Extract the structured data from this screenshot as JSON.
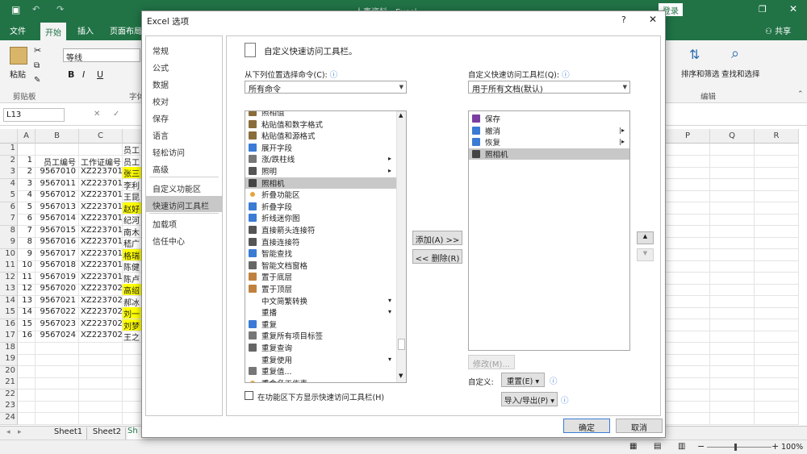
{
  "excel": {
    "title": "人事资料 - Excel",
    "login": "登录",
    "share": "共享",
    "tabs": [
      "文件",
      "开始",
      "插入",
      "页面布局"
    ],
    "ribbon": {
      "paste": "粘贴",
      "clipboard": "剪贴板",
      "font_name": "等线",
      "font_group": "字体",
      "sort_filter": "排序和筛选",
      "find_select": "查找和选择",
      "editing": "编辑"
    },
    "name_box": "L13",
    "columns": [
      "A",
      "B",
      "C",
      "P",
      "Q",
      "R"
    ],
    "rows": [
      {
        "n": "1",
        "a": "",
        "b": "",
        "c": "",
        "d": "员工"
      },
      {
        "n": "2",
        "a": "1",
        "b": "员工编号",
        "c": "工作证编号",
        "d": "员工"
      },
      {
        "n": "3",
        "a": "2",
        "b": "9567010",
        "c": "XZ223701",
        "d": "张三",
        "hl": true
      },
      {
        "n": "4",
        "a": "3",
        "b": "9567011",
        "c": "XZ223701",
        "d": "李利"
      },
      {
        "n": "5",
        "a": "4",
        "b": "9567012",
        "c": "XZ223701",
        "d": "王昆"
      },
      {
        "n": "6",
        "a": "5",
        "b": "9567013",
        "c": "XZ223701",
        "d": "赵好",
        "hl": true
      },
      {
        "n": "7",
        "a": "6",
        "b": "9567014",
        "c": "XZ223701",
        "d": "纪河"
      },
      {
        "n": "8",
        "a": "7",
        "b": "9567015",
        "c": "XZ223701",
        "d": "南木"
      },
      {
        "n": "9",
        "a": "8",
        "b": "9567016",
        "c": "XZ223701",
        "d": "嵇广"
      },
      {
        "n": "10",
        "a": "9",
        "b": "9567017",
        "c": "XZ223701",
        "d": "格瑞",
        "hl": true
      },
      {
        "n": "11",
        "a": "10",
        "b": "9567018",
        "c": "XZ223701",
        "d": "陈健"
      },
      {
        "n": "12",
        "a": "11",
        "b": "9567019",
        "c": "XZ223701",
        "d": "陈卢"
      },
      {
        "n": "13",
        "a": "12",
        "b": "9567020",
        "c": "XZ223702",
        "d": "高绍",
        "hl": true
      },
      {
        "n": "14",
        "a": "13",
        "b": "9567021",
        "c": "XZ223702",
        "d": "郝冰"
      },
      {
        "n": "15",
        "a": "14",
        "b": "9567022",
        "c": "XZ223702",
        "d": "刘一",
        "hl": true
      },
      {
        "n": "16",
        "a": "15",
        "b": "9567023",
        "c": "XZ223702",
        "d": "刘梦",
        "hl": true
      },
      {
        "n": "17",
        "a": "16",
        "b": "9567024",
        "c": "XZ223702",
        "d": "王之"
      },
      {
        "n": "18",
        "a": "",
        "b": "",
        "c": "",
        "d": ""
      },
      {
        "n": "19",
        "a": "",
        "b": "",
        "c": "",
        "d": ""
      },
      {
        "n": "20",
        "a": "",
        "b": "",
        "c": "",
        "d": ""
      },
      {
        "n": "21",
        "a": "",
        "b": "",
        "c": "",
        "d": ""
      },
      {
        "n": "22",
        "a": "",
        "b": "",
        "c": "",
        "d": ""
      },
      {
        "n": "23",
        "a": "",
        "b": "",
        "c": "",
        "d": ""
      },
      {
        "n": "24",
        "a": "",
        "b": "",
        "c": "",
        "d": ""
      }
    ],
    "sheets": [
      "Sheet1",
      "Sheet2",
      "Sh"
    ],
    "zoom": "100%"
  },
  "dialog": {
    "title": "Excel 选项",
    "help": "?",
    "close": "✕",
    "nav": [
      "常规",
      "公式",
      "数据",
      "校对",
      "保存",
      "语言",
      "轻松访问",
      "高级",
      "自定义功能区",
      "快速访问工具栏",
      "加载项",
      "信任中心"
    ],
    "heading": "自定义快速访问工具栏。",
    "choose_label": "从下列位置选择命令(C):",
    "choose_value": "所有命令",
    "customize_label": "自定义快速访问工具栏(Q):",
    "customize_value": "用于所有文档(默认)",
    "commands": [
      {
        "label": "照相值",
        "icon": "paste-icon"
      },
      {
        "label": "粘贴值和数字格式",
        "icon": "paste-icon"
      },
      {
        "label": "粘贴值和源格式",
        "icon": "paste-icon"
      },
      {
        "label": "展开字段",
        "icon": "expand-icon"
      },
      {
        "label": "涨/跌柱线",
        "icon": "chart-icon",
        "sub": "▸"
      },
      {
        "label": "照明",
        "icon": "light-icon",
        "sub": "▸"
      },
      {
        "label": "照相机",
        "icon": "camera-icon",
        "sel": true
      },
      {
        "label": "折叠功能区",
        "icon": "dot-icon"
      },
      {
        "label": "折叠字段",
        "icon": "collapse-icon"
      },
      {
        "label": "折线迷你图",
        "icon": "sparkline-icon"
      },
      {
        "label": "直接箭头连接符",
        "icon": "line-icon"
      },
      {
        "label": "直接连接符",
        "icon": "line-icon"
      },
      {
        "label": "智能查找",
        "icon": "search-icon"
      },
      {
        "label": "智能文档窗格",
        "icon": "doc-icon"
      },
      {
        "label": "置于底层",
        "icon": "layer-icon"
      },
      {
        "label": "置于顶层",
        "icon": "layer-icon"
      },
      {
        "label": "中文简繁转换",
        "icon": "blank-icon",
        "sub": "▾"
      },
      {
        "label": "重播",
        "icon": "blank-icon",
        "sub": "▾"
      },
      {
        "label": "重复",
        "icon": "redo-icon"
      },
      {
        "label": "重复所有项目标签",
        "icon": "table-icon"
      },
      {
        "label": "重复查询",
        "icon": "doc-icon"
      },
      {
        "label": "重复使用",
        "icon": "blank-icon",
        "sub": "▾"
      },
      {
        "label": "重复值...",
        "icon": "table-icon"
      },
      {
        "label": "重命名工作表",
        "icon": "dot-icon"
      }
    ],
    "qat": [
      {
        "label": "保存",
        "icon": "save-icon"
      },
      {
        "label": "撤消",
        "icon": "undo-icon",
        "sub": "|▸"
      },
      {
        "label": "恢复",
        "icon": "redo-icon",
        "sub": "|▸"
      },
      {
        "label": "照相机",
        "icon": "camera-icon",
        "sel": true
      }
    ],
    "add_button": "添加(A) >>",
    "remove_button": "<< 删除(R)",
    "modify_button": "修改(M)...",
    "custom_label": "自定义:",
    "reset_button": "重置(E) ▾",
    "import_export_button": "导入/导出(P) ▾",
    "show_below_label": "在功能区下方显示快速访问工具栏(H)",
    "ok_button": "确定",
    "cancel_button": "取消"
  }
}
